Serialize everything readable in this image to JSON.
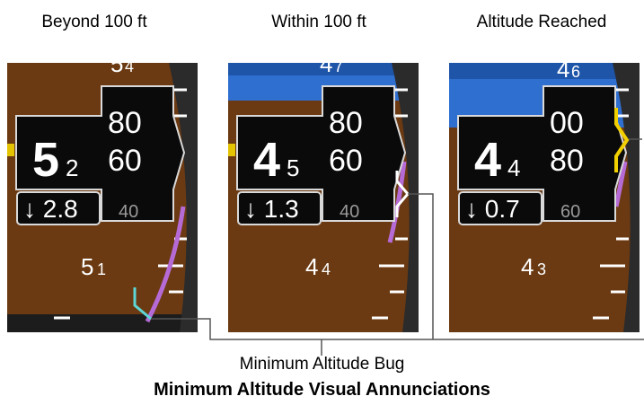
{
  "captions": {
    "beyond": "Beyond 100 ft",
    "within": "Within 100 ft",
    "reached": "Altitude Reached"
  },
  "panels": [
    {
      "id": "beyond",
      "tape_labels": {
        "top": "5",
        "top_small": "4",
        "lower": "5",
        "lower_small": "1"
      },
      "readout": {
        "big": "5",
        "small": "2",
        "upper": "80",
        "mid": "60",
        "low": "40"
      },
      "vertical_indicator": "↓ 2.8",
      "bug_color": "#5ed6d6"
    },
    {
      "id": "within",
      "tape_labels": {
        "top": "4",
        "top_small": "7",
        "lower": "4",
        "lower_small": "4"
      },
      "readout": {
        "big": "4",
        "small": "5",
        "upper": "80",
        "mid": "60",
        "low": "40"
      },
      "vertical_indicator": "↓ 1.3",
      "bug_color": "#ffffff"
    },
    {
      "id": "reached",
      "tape_labels": {
        "top": "4",
        "top_small": "6",
        "lower": "4",
        "lower_small": "3"
      },
      "readout": {
        "big": "4",
        "small": "4",
        "upper": "00",
        "mid": "80",
        "low": "60"
      },
      "vertical_indicator": "↓ 0.7",
      "bug_color": "#f2d000"
    }
  ],
  "labels": {
    "bug": "Minimum Altitude Bug",
    "title": "Minimum Altitude Visual Annunciations"
  },
  "colors": {
    "ground": "#6b3a12",
    "sky": "#2f6fd0",
    "trend": "#b66ad6",
    "leader": "#555555"
  }
}
